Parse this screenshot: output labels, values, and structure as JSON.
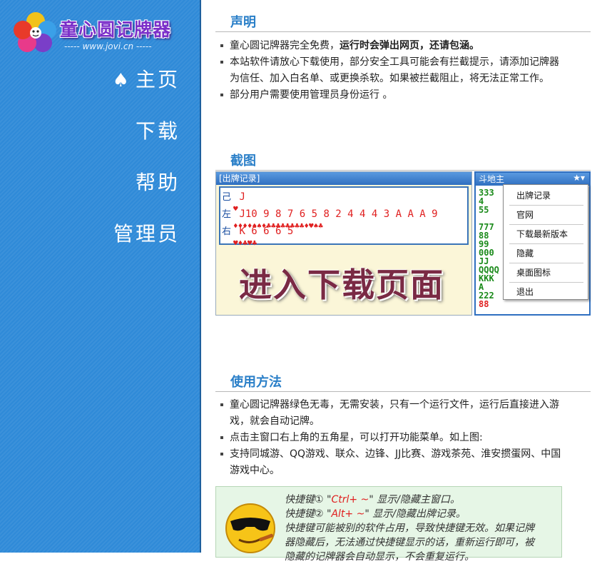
{
  "logo": {
    "title": "童心圆记牌器",
    "url": "----- www.jovi.cn -----"
  },
  "nav": [
    {
      "icon": "spade-icon",
      "glyph": "♠",
      "label": "主页"
    },
    {
      "label": "下载"
    },
    {
      "label": "帮助"
    },
    {
      "label": "管理员"
    }
  ],
  "notice": {
    "title": "声明",
    "items": [
      {
        "pre": "童心圆记牌器完全免费，",
        "bold": "运行时会弹出网页，还请包涵。"
      },
      {
        "text": "本站软件请放心下载使用，部分安全工具可能会有拦截提示，请添加记牌器为信任、加入白名单、或更换杀软。如果被拦截阻止，将无法正常工作。"
      },
      {
        "text": "部分用户需要使用管理员身份运行 。"
      }
    ]
  },
  "screenshot": {
    "title": "截图",
    "record_window_title": "[出牌记录]",
    "rows": [
      {
        "label": "己",
        "cards": "J",
        "suits": "♥"
      },
      {
        "label": "左",
        "cards": "J10 9 8 7 6 5  8  2  4 4 4 3  A A A 9",
        "suits": "♦♦♦♦♠♠♦♣♣♣♣♣♣♣♣♦♥♠♣"
      },
      {
        "label": "右",
        "cards": "K  6 6 6 5",
        "suits": "♥♦♣♥♣"
      }
    ],
    "enter_download": "进入下载页面",
    "ddz_window_title": "斗地主",
    "ddz_star": "★▾",
    "ddz_lines": [
      "333",
      "4",
      "55",
      "",
      "777",
      "88",
      "99",
      "000",
      "JJ",
      "QQQQ",
      "KKK",
      "A",
      "222",
      "88"
    ],
    "menu": [
      "出牌记录",
      "官网",
      "下载最新版本",
      "隐藏",
      "桌面图标",
      "退出"
    ]
  },
  "usage": {
    "title": "使用方法",
    "items": [
      "童心圆记牌器绿色无毒，无需安装，只有一个运行文件，运行后直接进入游戏，就会自动记牌。",
      "点击主窗口右上角的五角星，可以打开功能菜单。如上图:",
      "支持同城游、QQ游戏、联众、边锋、JJ比赛、游戏茶苑、淮安掼蛋网、中国游戏中心。"
    ]
  },
  "tips": {
    "line1_pre": "快捷键① \"",
    "line1_key": "Ctrl+ ~",
    "line1_post": "\" 显示/隐藏主窗口。",
    "line2_pre": "快捷键② \"",
    "line2_key": "Alt+ ~",
    "line2_post": "\" 显示/隐藏出牌记录。",
    "line3": "快捷键可能被别的软件占用，导致快捷键无效。如果记牌",
    "line4": "器隐藏后，无法通过快捷键显示的话，重新运行即可，被",
    "line5": "隐藏的记牌器会自动显示，不会重复运行。"
  }
}
